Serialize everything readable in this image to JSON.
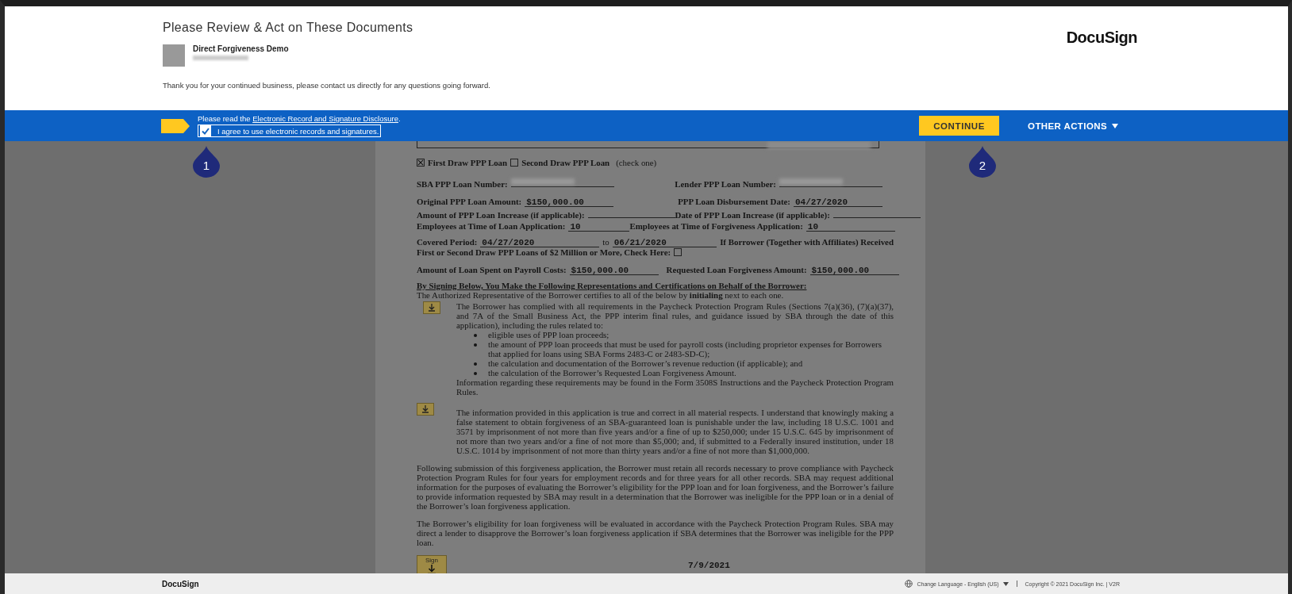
{
  "header": {
    "title": "Please Review & Act on These Documents",
    "sender_name": "Direct Forgiveness Demo",
    "message": "Thank you for your continued business, please contact us directly for any questions going forward.",
    "logo": "DocuSign"
  },
  "consent_bar": {
    "prefix": "Please read the ",
    "link": "Electronic Record and Signature Disclosure",
    "suffix": ".",
    "agree": {
      "label": "I agree to use electronic records and signatures.",
      "checked": true
    },
    "continue_button": "CONTINUE",
    "other_actions": "OTHER ACTIONS"
  },
  "markers": [
    {
      "number": "1"
    },
    {
      "number": "2"
    }
  ],
  "document": {
    "loan_type": [
      {
        "label": "First Draw PPP Loan",
        "checked": true
      },
      {
        "label": "Second Draw PPP Loan",
        "checked": false
      }
    ],
    "loan_type_note": "(check one)",
    "field_rows": [
      [
        {
          "label": "SBA PPP Loan Number:",
          "redacted": true
        },
        {
          "label": "Lender PPP Loan Number:",
          "redacted": true
        }
      ],
      [
        {
          "label": "Original PPP Loan Amount:",
          "value": "$150,000.00"
        },
        {
          "label": "PPP Loan Disbursement Date:",
          "value": "04/27/2020"
        }
      ],
      [
        {
          "label": "Amount of PPP Loan Increase (if applicable):"
        },
        {
          "label": "Date of PPP Loan Increase (if applicable):"
        }
      ],
      [
        {
          "label": "Employees at Time of Loan Application:",
          "value": "10"
        },
        {
          "label": "Employees at Time of Forgiveness Application:",
          "value": "10"
        }
      ]
    ],
    "covered_period": {
      "label": "Covered Period:",
      "start": "04/27/2020",
      "to": "to",
      "end": "06/21/2020",
      "question_start": "If Borrower (Together with Affiliates) Received",
      "question_end": "First or Second Draw PPP Loans of $2 Million or More, Check Here:",
      "checked": false
    },
    "amounts_row": [
      {
        "label": "Amount of Loan Spent on Payroll Costs:",
        "value": "$150,000.00"
      },
      {
        "label": "Requested Loan Forgiveness Amount:",
        "value": "$150,000.00"
      }
    ],
    "heading": "By Signing Below, You Make the Following Representations and Certifications on Behalf of the Borrower:",
    "intro": "The Authorized Representative of the Borrower certifies to all of the below by **initialing** next to each one.",
    "certifications": [
      {
        "text": "The Borrower has complied with all requirements in the Paycheck Protection Program Rules (Sections 7(a)(36), (7)(a)(37), and 7A of the Small Business Act, the PPP interim final rules, and guidance issued by SBA through the date of this application), including the rules related to:",
        "bullets": [
          "eligible uses of PPP loan proceeds;",
          "the amount of PPP loan proceeds that must be used for payroll costs (including proprietor expenses for Borrowers that applied for loans using SBA Forms 2483-C or 2483-SD-C);",
          "the calculation and documentation of the Borrower’s revenue reduction (if applicable); and",
          "the calculation of the Borrower’s Requested Loan Forgiveness Amount."
        ],
        "after": "Information regarding these requirements may be found in the Form 3508S Instructions and the Paycheck Protection Program Rules."
      },
      {
        "text": "The information provided in this application is true and correct in all material respects.  I understand that knowingly making a false statement to obtain forgiveness of an SBA-guaranteed loan is punishable under the law, including 18 U.S.C. 1001 and 3571 by imprisonment of not more than five years and/or a fine of up to $250,000; under 15 U.S.C. 645 by imprisonment of not more than two years and/or a fine of not more than $5,000; and, if submitted to a Federally insured institution, under 18 U.S.C. 1014 by imprisonment of not more than thirty years and/or a fine of not more than $1,000,000."
      }
    ],
    "paragraphs": [
      "Following submission of this forgiveness application, the Borrower must retain all records necessary to prove compliance with Paycheck Protection Program Rules for four years for employment records and for three years for all other records.  SBA may request additional information for the purposes of evaluating the Borrower’s eligibility for the PPP loan and for loan forgiveness, and the Borrower’s failure to provide information requested by SBA may result in a determination that the Borrower was ineligible for the PPP loan or in a denial of the Borrower’s loan forgiveness application.",
      "The Borrower’s eligibility for loan forgiveness will be evaluated in accordance with the Paycheck Protection Program Rules.  SBA may direct a lender to disapprove the Borrower’s loan forgiveness application if SBA determines that the Borrower was ineligible for the PPP loan."
    ],
    "signature": {
      "sign_label": "Sign",
      "date": "7/9/2021"
    }
  },
  "footer": {
    "logo": "DocuSign",
    "language": "Change Language - English (US)",
    "copyright": "Copyright © 2021 DocuSign Inc. | V2R"
  }
}
